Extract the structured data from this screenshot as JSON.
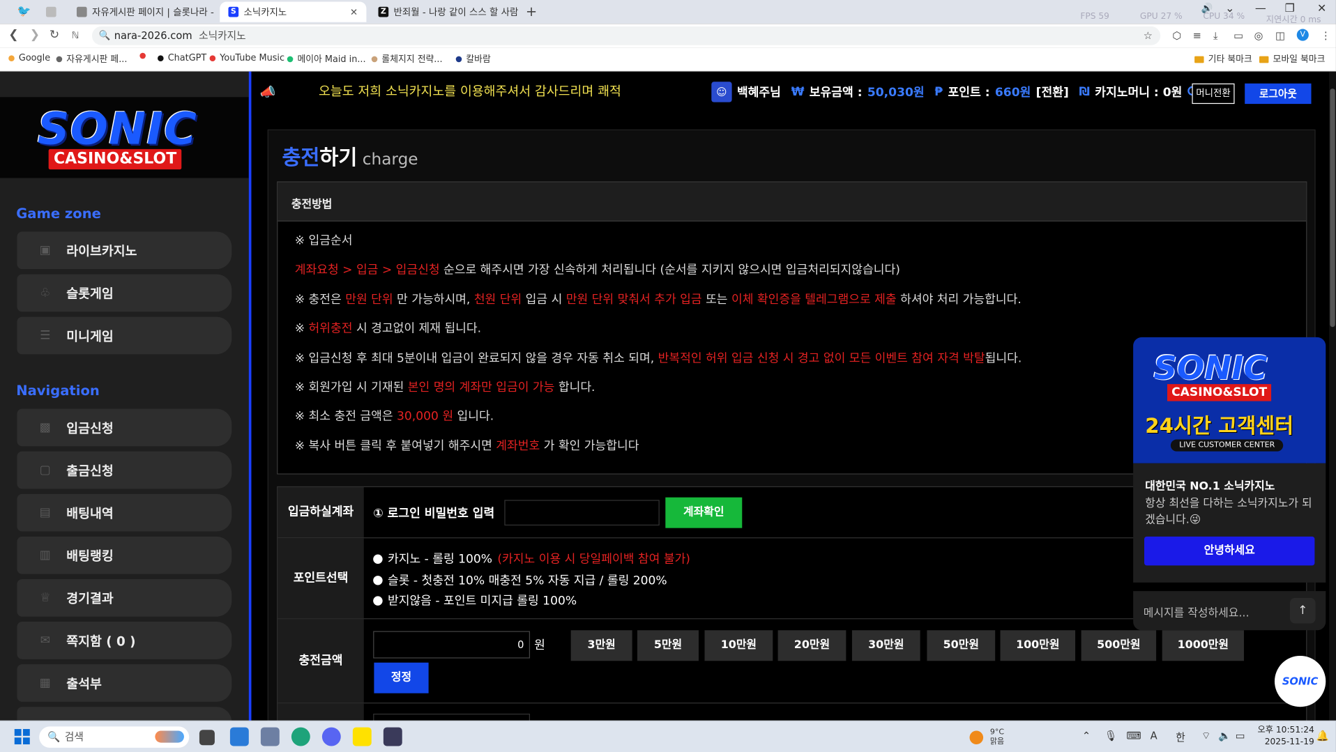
{
  "browser": {
    "tabs": [
      {
        "title": "",
        "active": false
      },
      {
        "title": "자유게시판 페이지 | 슬롯나라 - ",
        "active": false
      },
      {
        "title": "소닉카지노",
        "active": true
      },
      {
        "title": "반죄월 - 나랑 같이 스스 할 사람",
        "active": false
      }
    ],
    "sysinfo": {
      "fps": "FPS 59",
      "gpu": "GPU 27 %",
      "cpu": "CPU 34 %",
      "latency": "지연시간 0 ms"
    },
    "url": "nara-2026.com",
    "site_name": "소닉카지노",
    "bookmarks": [
      {
        "label": "Google",
        "color": "#f4a63a"
      },
      {
        "label": "자유게시판 페...",
        "color": "#666666"
      },
      {
        "label": "",
        "color": "#e53935"
      },
      {
        "label": "ChatGPT",
        "color": "#111111"
      },
      {
        "label": "YouTube Music",
        "color": "#e53935"
      },
      {
        "label": "메이아 Maid in...",
        "color": "#1dbf73"
      },
      {
        "label": "롤체지지 전략...",
        "color": "#c9a27a"
      },
      {
        "label": "칼바람",
        "color": "#1e3a8a"
      }
    ],
    "bookmark_folders": [
      "기타 북마크",
      "모바일 북마크"
    ],
    "avatar_letter": "V"
  },
  "sidebar": {
    "logo_main": "SONIC",
    "logo_sub": "CASINO&SLOT",
    "game_zone_title": "Game zone",
    "game_zone_items": [
      {
        "label": "라이브카지노",
        "icon": "dice-icon"
      },
      {
        "label": "슬롯게임",
        "icon": "slot-icon"
      },
      {
        "label": "미니게임",
        "icon": "minigame-icon"
      }
    ],
    "navigation_title": "Navigation",
    "navigation_items": [
      {
        "label": "입금신청",
        "icon": "deposit-icon"
      },
      {
        "label": "출금신청",
        "icon": "withdraw-icon"
      },
      {
        "label": "배팅내역",
        "icon": "history-icon"
      },
      {
        "label": "배팅랭킹",
        "icon": "ranking-icon"
      },
      {
        "label": "경기결과",
        "icon": "trophy-icon"
      },
      {
        "label": "쪽지함 ( 0 )",
        "icon": "message-icon"
      },
      {
        "label": "출석부",
        "icon": "calendar-icon"
      }
    ]
  },
  "topbar": {
    "marquee": "오늘도 저희 소닉카지노를 이용해주셔서 감사드리며 쾌적",
    "username": "백혜주님",
    "balance_label": "보유금액 :",
    "balance_value": "50,030원",
    "point_label": "포인트 :",
    "point_value": "660원",
    "point_convert": "[전환]",
    "casino_money_label": "카지노머니 : 0원",
    "money_convert_button": "머니전환",
    "logout_button": "로그아웃"
  },
  "charge": {
    "title_ko_blue": "충전",
    "title_ko_white": "하기",
    "title_en": "charge",
    "method_header": "충전방법",
    "lines": [
      [
        {
          "t": "※ 입금순서",
          "red": false
        }
      ],
      [
        {
          "t": "계좌요청 > 입금 > 입금신청",
          "red": true
        },
        {
          "t": " 순으로 해주시면 가장 신속하게 처리됩니다 (순서를 지키지 않으시면 입금처리되지않습니다)",
          "red": false
        }
      ],
      [
        {
          "t": "※ 충전은 ",
          "red": false
        },
        {
          "t": "만원 단위",
          "red": true
        },
        {
          "t": " 만 가능하시며, ",
          "red": false
        },
        {
          "t": "천원 단위",
          "red": true
        },
        {
          "t": " 입금 시 ",
          "red": false
        },
        {
          "t": "만원 단위 맞춰서 추가 입금",
          "red": true
        },
        {
          "t": " 또는 ",
          "red": false
        },
        {
          "t": "이체 확인증을 텔레그램으로 제출",
          "red": true
        },
        {
          "t": " 하셔야 처리 가능합니다.",
          "red": false
        }
      ],
      [
        {
          "t": "※ ",
          "red": false
        },
        {
          "t": "허위충전",
          "red": true
        },
        {
          "t": " 시 경고없이 제재 됩니다.",
          "red": false
        }
      ],
      [
        {
          "t": "※ 입금신청 후 최대 5분이내 입금이 완료되지 않을 경우 자동 취소 되며, ",
          "red": false
        },
        {
          "t": "반복적인 허위 입금 신청 시 경고 없이 모든 이벤트 참여 자격 박탈",
          "red": true
        },
        {
          "t": "됩니다.",
          "red": false
        }
      ],
      [
        {
          "t": "※ 회원가입 시 기재된 ",
          "red": false
        },
        {
          "t": "본인 명의 계좌만 입금이 가능",
          "red": true
        },
        {
          "t": " 합니다.",
          "red": false
        }
      ],
      [
        {
          "t": "※ 최소 충전 금액은 ",
          "red": false
        },
        {
          "t": "30,000 원",
          "red": true
        },
        {
          "t": " 입니다.",
          "red": false
        }
      ],
      [
        {
          "t": "※ 복사 버튼 클릭 후 붙여넣기 해주시면 ",
          "red": false
        },
        {
          "t": "계좌번호",
          "red": true
        },
        {
          "t": " 가 확인 가능합니다",
          "red": false
        }
      ]
    ],
    "account_label": "입금하실계좌",
    "password_label": "① 로그인 비밀번호 입력",
    "account_check_button": "계좌확인",
    "point_select_label": "포인트선택",
    "point_options": [
      {
        "text": "카지노 - 롤링 100%",
        "note": "(카지노 이용 시 당일페이백 참여 불가)"
      },
      {
        "text": "슬롯 - 첫충전 10% 매충전 5% 자동 지급 / 롤링 200%",
        "note": ""
      },
      {
        "text": "받지않음 - 포인트 미지급 롤링 100%",
        "note": ""
      }
    ],
    "amount_label": "충전금액",
    "amount_value": "0",
    "amount_unit": "원",
    "amount_buttons": [
      "3만원",
      "5만원",
      "10만원",
      "20만원",
      "30만원",
      "50만원",
      "100만원",
      "500만원",
      "1000만원"
    ],
    "reset_button": "정정"
  },
  "chat": {
    "banner_main": "SONIC",
    "banner_sub": "CASINO&SLOT",
    "banner_24": "24시간 고객센터",
    "banner_live": "LIVE CUSTOMER CENTER",
    "name": "대한민국 NO.1 소닉카지노",
    "desc": "항상 최선을 다하는 소닉카지노가 되겠습니다.😜",
    "hello_button": "안녕하세요",
    "input_placeholder": "메시지를 작성하세요...",
    "float_logo": "SONIC"
  },
  "taskbar": {
    "search_placeholder": "검색",
    "weather_temp": "9°C",
    "weather_desc": "맑음",
    "ime": "한",
    "time": "오후 10:51:24",
    "date": "2025-11-19"
  },
  "colors": {
    "accent": "#1247e8",
    "danger": "#e52222",
    "confirm": "#16b83a",
    "marquee": "#f0e050"
  }
}
